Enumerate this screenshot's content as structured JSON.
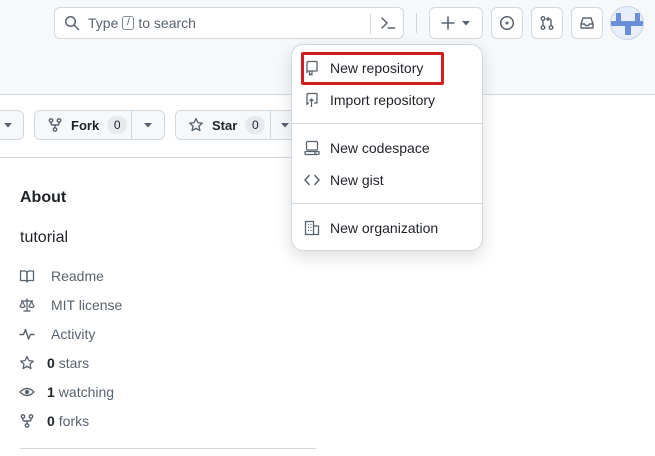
{
  "header": {
    "search": {
      "prefix": "Type",
      "key": "/",
      "suffix": "to search"
    }
  },
  "repo_actions": {
    "fork_label": "Fork",
    "fork_count": "0",
    "star_label": "Star",
    "star_count": "0"
  },
  "about": {
    "title": "About",
    "description": "tutorial",
    "items": [
      {
        "icon": "book-icon",
        "count": "",
        "label": "Readme"
      },
      {
        "icon": "law-icon",
        "count": "",
        "label": "MIT license"
      },
      {
        "icon": "pulse-icon",
        "count": "",
        "label": "Activity"
      },
      {
        "icon": "star-icon",
        "count": "0",
        "label": "stars"
      },
      {
        "icon": "eye-icon",
        "count": "1",
        "label": "watching"
      },
      {
        "icon": "fork-icon",
        "count": "0",
        "label": "forks"
      }
    ]
  },
  "create_menu": {
    "items": [
      {
        "icon": "repo-icon",
        "label": "New repository"
      },
      {
        "icon": "repo-push-icon",
        "label": "Import repository"
      },
      {
        "icon": "codespaces-icon",
        "label": "New codespace"
      },
      {
        "icon": "code-icon",
        "label": "New gist"
      },
      {
        "icon": "organization-icon",
        "label": "New organization"
      }
    ],
    "highlighted_item": "New repository"
  },
  "colors": {
    "highlight": "#d21f1f",
    "text": "#1f2328",
    "muted": "#59636e",
    "border": "#d1d9e0"
  }
}
